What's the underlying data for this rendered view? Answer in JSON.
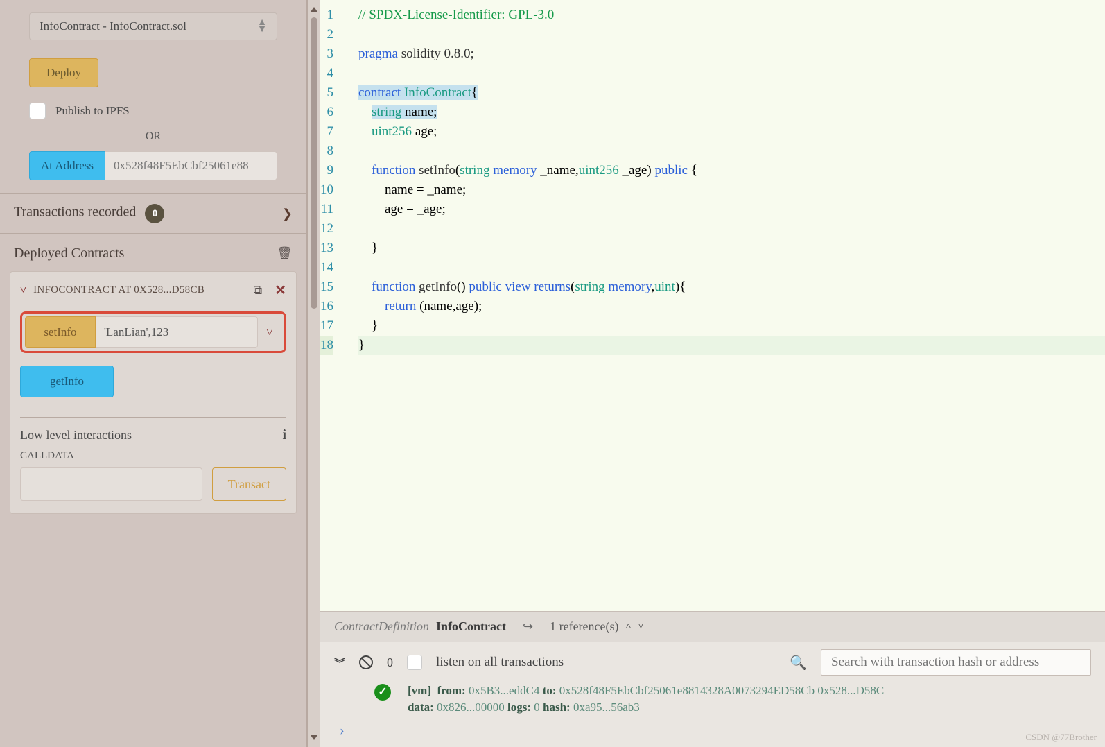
{
  "sidebar": {
    "contract_select": "InfoContract - InfoContract.sol",
    "deploy_btn": "Deploy",
    "publish_label": "Publish to IPFS",
    "or_label": "OR",
    "at_address_btn": "At Address",
    "address_placeholder": "0x528f48F5EbCbf25061e88",
    "transactions_label": "Transactions recorded",
    "transactions_count": "0",
    "deployed_label": "Deployed Contracts",
    "instance_title": "INFOCONTRACT AT 0X528...D58CB",
    "fn_setinfo": "setInfo",
    "fn_setinfo_args": "'LanLian',123",
    "fn_getinfo": "getInfo",
    "lowlevel_label": "Low level interactions",
    "calldata_label": "CALLDATA",
    "transact_btn": "Transact"
  },
  "code_lines": [
    {
      "n": 1,
      "html": "<span class='c-cmt'>// SPDX-License-Identifier: GPL-3.0</span>"
    },
    {
      "n": 2,
      "html": ""
    },
    {
      "n": 3,
      "html": "<span class='c-kw'>pragma</span> <span class='c-txt'>solidity 0.8.0;</span>"
    },
    {
      "n": 4,
      "html": ""
    },
    {
      "n": 5,
      "html": "<span class='c-hl'><span class='c-kw'>contract</span> <span class='c-type'>InfoContract</span>{</span>"
    },
    {
      "n": 6,
      "html": "    <span class='c-hl'><span class='c-type'>string</span> name;</span>"
    },
    {
      "n": 7,
      "html": "    <span class='c-type'>uint256</span> age;"
    },
    {
      "n": 8,
      "html": ""
    },
    {
      "n": 9,
      "html": "    <span class='c-kw'>function</span> <span class='c-func'>setInfo</span>(<span class='c-type'>string</span> <span class='c-kw'>memory</span> _name,<span class='c-type'>uint256</span> _age) <span class='c-kw'>public</span> {"
    },
    {
      "n": 10,
      "html": "        name = _name;"
    },
    {
      "n": 11,
      "html": "        age = _age;"
    },
    {
      "n": 12,
      "html": ""
    },
    {
      "n": 13,
      "html": "    }"
    },
    {
      "n": 14,
      "html": ""
    },
    {
      "n": 15,
      "html": "    <span class='c-kw'>function</span> <span class='c-func'>getInfo</span>() <span class='c-kw'>public</span> <span class='c-kw'>view</span> <span class='c-kw'>returns</span>(<span class='c-type'>string</span> <span class='c-kw'>memory</span>,<span class='c-type'>uint</span>){"
    },
    {
      "n": 16,
      "html": "        <span class='c-kw'>return</span> (name,age);"
    },
    {
      "n": 17,
      "html": "    }"
    },
    {
      "n": 18,
      "html": "<span class='line-curr'>}</span>"
    }
  ],
  "statusbar": {
    "cd": "ContractDefinition",
    "name": "InfoContract",
    "refs": "1 reference(s)"
  },
  "terminal": {
    "count": "0",
    "listen_label": "listen on all transactions",
    "search_placeholder": "Search with transaction hash or address",
    "tx_vm": "[vm]",
    "tx_from_lbl": "from:",
    "tx_from": "0x5B3...eddC4",
    "tx_to_lbl": "to:",
    "tx_to": "0x528f48F5EbCbf25061e8814328A0073294ED58Cb 0x528...D58C",
    "tx_data_lbl": "data:",
    "tx_data": "0x826...00000",
    "tx_logs_lbl": "logs:",
    "tx_logs": "0",
    "tx_hash_lbl": "hash:",
    "tx_hash": "0xa95...56ab3"
  },
  "watermark": "CSDN @77Brother"
}
